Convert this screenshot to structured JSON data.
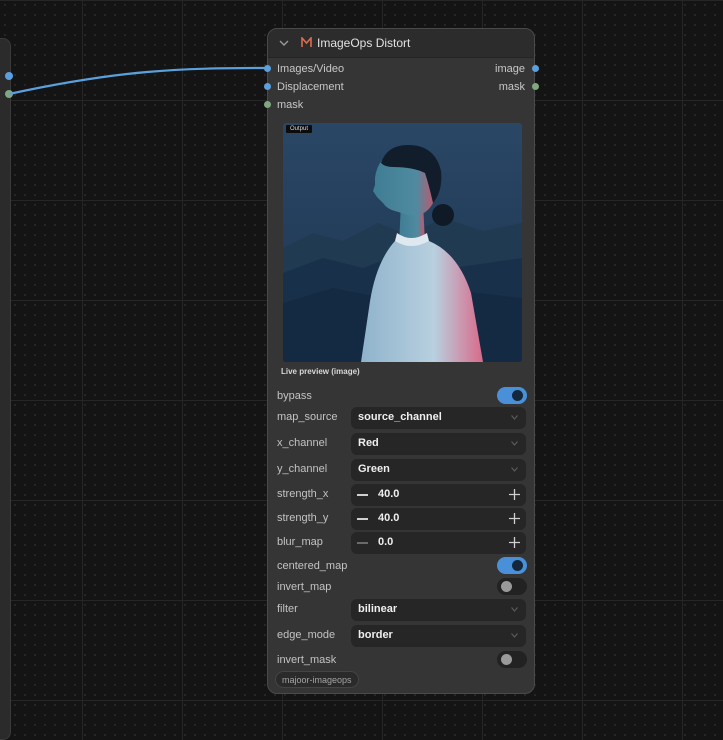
{
  "colors": {
    "image_port": "#5a9fe0",
    "mask_port": "#7fa87f",
    "toggle_on": "#4a90d9",
    "logo_accent": "#e06a4f"
  },
  "node": {
    "title": "ImageOps Distort",
    "inputs": [
      {
        "label": "Images/Video",
        "type": "image"
      },
      {
        "label": "Displacement",
        "type": "image"
      },
      {
        "label": "mask",
        "type": "mask"
      }
    ],
    "outputs": [
      {
        "label": "image",
        "type": "image"
      },
      {
        "label": "mask",
        "type": "mask"
      }
    ],
    "preview": {
      "tag": "Output",
      "caption": "Live preview (image)"
    },
    "widgets": {
      "bypass": {
        "label": "bypass",
        "value": true
      },
      "map_source": {
        "label": "map_source",
        "value": "source_channel"
      },
      "x_channel": {
        "label": "x_channel",
        "value": "Red"
      },
      "y_channel": {
        "label": "y_channel",
        "value": "Green"
      },
      "strength_x": {
        "label": "strength_x",
        "value": "40.0"
      },
      "strength_y": {
        "label": "strength_y",
        "value": "40.0"
      },
      "blur_map": {
        "label": "blur_map",
        "value": "0.0"
      },
      "centered_map": {
        "label": "centered_map",
        "value": true
      },
      "invert_map": {
        "label": "invert_map",
        "value": false
      },
      "filter": {
        "label": "filter",
        "value": "bilinear"
      },
      "edge_mode": {
        "label": "edge_mode",
        "value": "border"
      },
      "invert_mask": {
        "label": "invert_mask",
        "value": false
      }
    },
    "badge": "majoor-imageops"
  }
}
